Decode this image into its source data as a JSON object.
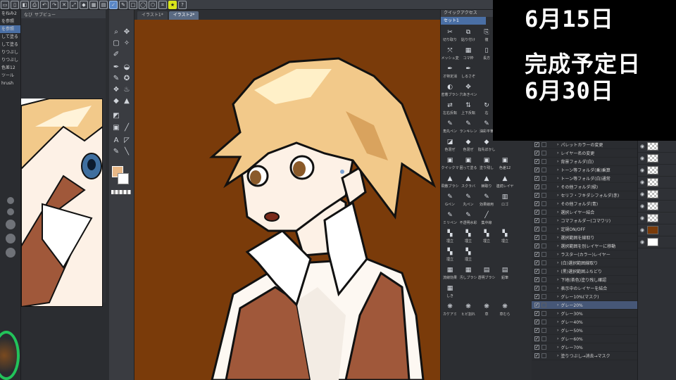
{
  "overlay": {
    "date_line": "6月15日",
    "deadline_label": "完成予定日",
    "deadline_date": "6月30日"
  },
  "subview": {
    "tabs": [
      "なび",
      "サブビュー"
    ]
  },
  "document_tabs": [
    {
      "label": "イラスト1*",
      "active": false
    },
    {
      "label": "イラスト2*",
      "active": true
    }
  ],
  "left_panel": {
    "rows": [
      "をねみ2",
      "を参照",
      "を参照",
      "して塗る",
      "して塗る",
      "りつぶし",
      "りつぶし",
      "色差12",
      "ツール",
      "hrush"
    ]
  },
  "quick_access": {
    "title": "クイックアクセス",
    "set_label": "セット1",
    "items": [
      {
        "icon": "✂",
        "label": "切り取り"
      },
      {
        "icon": "⧉",
        "label": "貼り付け"
      },
      {
        "icon": "⎘",
        "label": "複"
      },
      {
        "icon": "",
        "label": ""
      },
      {
        "icon": "",
        "label": ""
      },
      {
        "icon": "⤧",
        "label": "メッシュ変形"
      },
      {
        "icon": "▦",
        "label": "コマ枠"
      },
      {
        "icon": "▯",
        "label": "長方"
      },
      {
        "icon": "",
        "label": ""
      },
      {
        "icon": "",
        "label": ""
      },
      {
        "icon": "✒",
        "label": "オ特定消"
      },
      {
        "icon": "✒",
        "label": "しるさぞ"
      },
      {
        "icon": "",
        "label": ""
      },
      {
        "icon": "",
        "label": ""
      },
      {
        "icon": "",
        "label": ""
      },
      {
        "icon": "◐",
        "label": "密着ブラシ"
      },
      {
        "icon": "✥",
        "label": "穴あきペン"
      },
      {
        "icon": "",
        "label": ""
      },
      {
        "icon": "",
        "label": ""
      },
      {
        "icon": "",
        "label": ""
      },
      {
        "icon": "⇄",
        "label": "左右反転"
      },
      {
        "icon": "⇅",
        "label": "上下反転"
      },
      {
        "icon": "↻",
        "label": "右"
      },
      {
        "icon": "",
        "label": ""
      },
      {
        "icon": "",
        "label": ""
      },
      {
        "icon": "✎",
        "label": "角丸ペン"
      },
      {
        "icon": "✎",
        "label": "ランキレン"
      },
      {
        "icon": "✎",
        "label": "油彩平筆"
      },
      {
        "icon": "✎",
        "label": "ゆがみ"
      },
      {
        "icon": "",
        "label": ""
      },
      {
        "icon": "◪",
        "label": "色混ぜ"
      },
      {
        "icon": "◆",
        "label": "色混ぜ"
      },
      {
        "icon": "◆",
        "label": "指先ぼかし"
      },
      {
        "icon": "",
        "label": ""
      },
      {
        "icon": "",
        "label": ""
      },
      {
        "icon": "▣",
        "label": "クイックマ"
      },
      {
        "icon": "▣",
        "label": "囲って塗る"
      },
      {
        "icon": "▣",
        "label": "塗り残し"
      },
      {
        "icon": "▣",
        "label": "色差12"
      },
      {
        "icon": "",
        "label": ""
      },
      {
        "icon": "▲",
        "label": "飛散ブラシ"
      },
      {
        "icon": "▲",
        "label": "スクラバ"
      },
      {
        "icon": "▲",
        "label": "棘取り"
      },
      {
        "icon": "▲",
        "label": "連続レイヤ"
      },
      {
        "icon": "",
        "label": ""
      },
      {
        "icon": "✎",
        "label": "Gペン"
      },
      {
        "icon": "✎",
        "label": "丸ペン"
      },
      {
        "icon": "✎",
        "label": "効果線用"
      },
      {
        "icon": "▥",
        "label": "ロゴ"
      },
      {
        "icon": "",
        "label": ""
      },
      {
        "icon": "✎",
        "label": "ミリペン"
      },
      {
        "icon": "✎",
        "label": "不透明水彩"
      },
      {
        "icon": "╱",
        "label": "集中線"
      },
      {
        "icon": "",
        "label": ""
      },
      {
        "icon": "",
        "label": ""
      },
      {
        "icon": "▚",
        "label": "埋立"
      },
      {
        "icon": "▚",
        "label": "埋立"
      },
      {
        "icon": "▚",
        "label": "埋立"
      },
      {
        "icon": "▚",
        "label": "埋立"
      },
      {
        "icon": "",
        "label": ""
      },
      {
        "icon": "▚",
        "label": "埋立"
      },
      {
        "icon": "▚",
        "label": "埋立"
      },
      {
        "icon": "",
        "label": ""
      },
      {
        "icon": "",
        "label": ""
      },
      {
        "icon": "",
        "label": ""
      },
      {
        "icon": "▦",
        "label": "流線効果"
      },
      {
        "icon": "▦",
        "label": "汚しブラシ"
      },
      {
        "icon": "▤",
        "label": "透明ブラシ"
      },
      {
        "icon": "▤",
        "label": "鉛筆"
      },
      {
        "icon": "",
        "label": ""
      },
      {
        "icon": "▦",
        "label": "しき"
      },
      {
        "icon": "",
        "label": ""
      },
      {
        "icon": "",
        "label": ""
      },
      {
        "icon": "",
        "label": ""
      },
      {
        "icon": "",
        "label": ""
      },
      {
        "icon": "❋",
        "label": "カケアミ"
      },
      {
        "icon": "❋",
        "label": "ヒビ割れ"
      },
      {
        "icon": "❋",
        "label": "草"
      },
      {
        "icon": "❋",
        "label": "草むら"
      },
      {
        "icon": "",
        "label": ""
      }
    ]
  },
  "auto_actions": [
    {
      "label": "パレットカラーの変更",
      "checked": true,
      "selected": false
    },
    {
      "label": "レイヤー名の変更",
      "checked": true,
      "selected": false
    },
    {
      "label": "背景フォルダ(白)",
      "checked": true,
      "selected": false
    },
    {
      "label": "トーン等フォルダ(乗)乗算",
      "checked": true,
      "selected": false
    },
    {
      "label": "トーン等フォルダ(白)通常",
      "checked": true,
      "selected": false
    },
    {
      "label": "その他フォルダ(緑)",
      "checked": true,
      "selected": false
    },
    {
      "label": "セリフ・フキダシフォルダ(赤)",
      "checked": true,
      "selected": false
    },
    {
      "label": "その他フォルダ(青)",
      "checked": true,
      "selected": false
    },
    {
      "label": "選択レイヤー結合",
      "checked": true,
      "selected": false
    },
    {
      "label": "コマフォルダー(コマワリ)",
      "checked": true,
      "selected": false
    },
    {
      "label": "定規ON/OFF",
      "checked": true,
      "selected": false
    },
    {
      "label": "選択範囲を線取り",
      "checked": true,
      "selected": false
    },
    {
      "label": "選択範囲を別レイヤーに移動",
      "checked": true,
      "selected": false
    },
    {
      "label": "ラスター(カラー)レイヤー",
      "checked": true,
      "selected": false
    },
    {
      "label": "(白)選択範囲線取り",
      "checked": true,
      "selected": false
    },
    {
      "label": "(黒)選択範囲ふちどり",
      "checked": true,
      "selected": false
    },
    {
      "label": "下地(茶色)塗り残し確認",
      "checked": true,
      "selected": false
    },
    {
      "label": "表示中のレイヤーを結合",
      "checked": true,
      "selected": false
    },
    {
      "label": "グレー10%(マスク)",
      "checked": true,
      "selected": false
    },
    {
      "label": "グレー20%",
      "checked": true,
      "selected": true
    },
    {
      "label": "グレー30%",
      "checked": true,
      "selected": false
    },
    {
      "label": "グレー40%",
      "checked": true,
      "selected": false
    },
    {
      "label": "グレー50%",
      "checked": true,
      "selected": false
    },
    {
      "label": "グレー60%",
      "checked": true,
      "selected": false
    },
    {
      "label": "グレー70%",
      "checked": true,
      "selected": false
    },
    {
      "label": "塗りつぶし→消去→マスク",
      "checked": true,
      "selected": false
    }
  ],
  "colors": {
    "canvas_bg": "#7a3b0a",
    "hair": "#f2c98a",
    "hair_shade": "#d9a35e",
    "skin": "#fdf1e6",
    "vest": "#a0583a",
    "accent": "#4a6fa5",
    "highlight_yellow": "#d9e61a",
    "ring_green": "#22c35a"
  }
}
